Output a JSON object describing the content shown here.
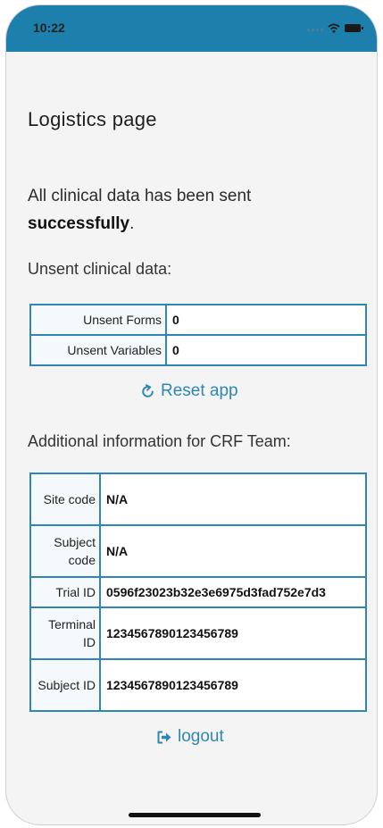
{
  "status_bar": {
    "time": "10:22",
    "accent_color": "#1d7fab"
  },
  "page": {
    "title": "Logistics page",
    "sent_message_prefix": "All clinical data has been sent",
    "sent_message_bold": "successfully",
    "sent_message_suffix": ".",
    "unsent_heading": "Unsent clinical data:",
    "additional_heading": "Additional information for CRF Team:"
  },
  "unsent_table": {
    "rows": [
      {
        "label": "Unsent Forms",
        "value": "0"
      },
      {
        "label": "Unsent Variables",
        "value": "0"
      }
    ]
  },
  "reset_button": {
    "label": "Reset app",
    "icon": "refresh-icon"
  },
  "crf_table": {
    "rows": [
      {
        "label": "Site code",
        "value": "N/A"
      },
      {
        "label": "Subject code",
        "value": "N/A"
      },
      {
        "label": "Trial ID",
        "value": "0596f23023b32e3e6975d3fad752e7d3"
      },
      {
        "label": "Terminal ID",
        "value": "1234567890123456789"
      },
      {
        "label": "Subject ID",
        "value": "1234567890123456789"
      }
    ]
  },
  "logout_button": {
    "label": "logout",
    "icon": "sign-out-icon"
  }
}
